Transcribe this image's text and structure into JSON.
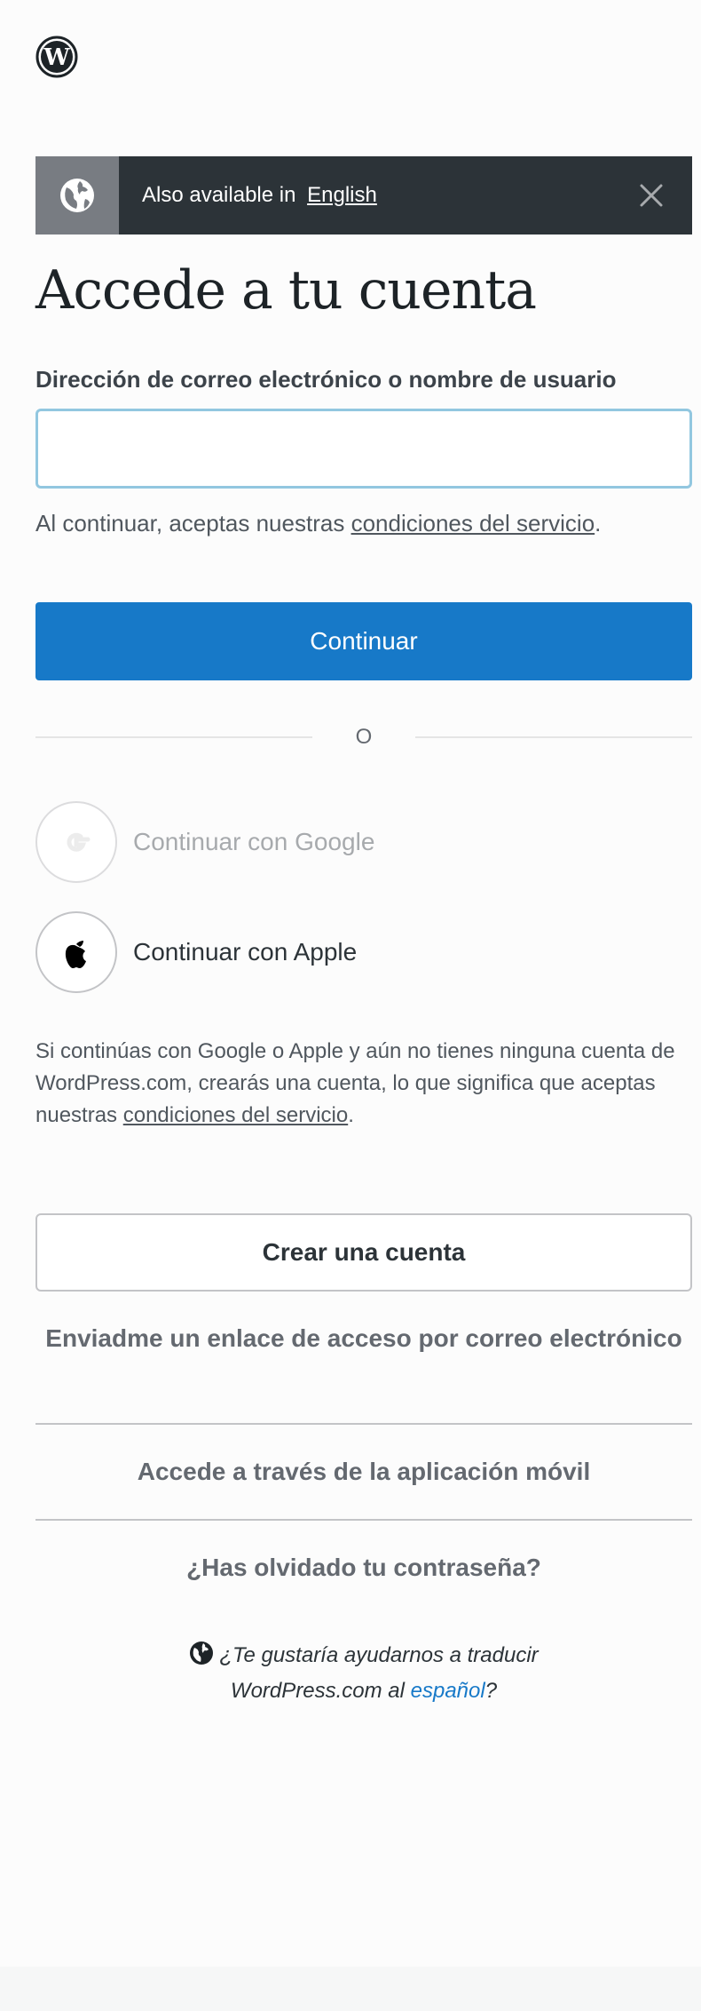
{
  "banner": {
    "prefix": "Also available in",
    "language_link": "English"
  },
  "page_title": "Accede a tu cuenta",
  "login_field": {
    "label": "Dirección de correo electrónico o nombre de usuario",
    "value": "",
    "placeholder": ""
  },
  "tos": {
    "prefix": "Al continuar, aceptas nuestras",
    "link": "condiciones del servicio",
    "suffix": "."
  },
  "continue_button": "Continuar",
  "divider_text": "O",
  "social": {
    "google_label": "Continuar con Google",
    "apple_label": "Continuar con Apple"
  },
  "social_note": {
    "text": "Si continúas con Google o Apple y aún no tienes ninguna cuenta de WordPress.com, crearás una cuenta, lo que significa que aceptas nuestras",
    "link": "condiciones del servicio",
    "suffix": "."
  },
  "create_account_button": "Crear una cuenta",
  "links": {
    "email_link": "Enviadme un enlace de acceso por correo electrónico",
    "mobile_app": "Accede a través de la aplicación móvil",
    "forgot_password": "¿Has olvidado tu contraseña?"
  },
  "translate": {
    "line1": "¿Te gustaría ayudarnos a traducir",
    "line2_prefix": "WordPress.com al",
    "language_link": "español",
    "line2_suffix": "?"
  },
  "colors": {
    "primary_blue": "#1779c8",
    "banner_dark": "#2c3338",
    "banner_globe_bg": "#787c82",
    "input_focus_border": "#92c7e0"
  },
  "icons": [
    "wordpress-logo-icon",
    "globe-icon",
    "close-icon",
    "google-icon",
    "apple-icon"
  ]
}
